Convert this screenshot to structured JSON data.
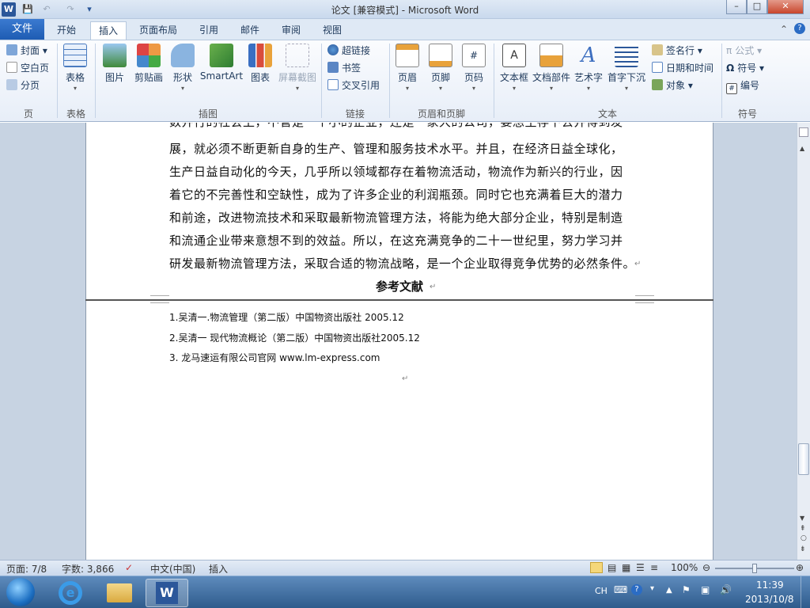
{
  "window": {
    "title": "论文 [兼容模式] - Microsoft Word",
    "minimize": "–",
    "maximize": "□",
    "close": "✕"
  },
  "qat": {
    "app_icon": "W",
    "save": "💾",
    "undo": "↶",
    "redo": "↷",
    "customize": "▾"
  },
  "tabs": {
    "file": "文件",
    "items": [
      "开始",
      "插入",
      "页面布局",
      "引用",
      "邮件",
      "审阅",
      "视图"
    ],
    "active": "插入"
  },
  "ribbon": {
    "page_group": {
      "label": "页",
      "items": [
        "封面",
        "空白页",
        "分页"
      ]
    },
    "table_group": {
      "label": "表格",
      "table": "表格"
    },
    "illustrations_group": {
      "label": "插图",
      "items": [
        "图片",
        "剪贴画",
        "形状",
        "SmartArt",
        "图表",
        "屏幕截图"
      ]
    },
    "links_group": {
      "label": "链接",
      "items": [
        "超链接",
        "书签",
        "交叉引用"
      ]
    },
    "header_footer_group": {
      "label": "页眉和页脚",
      "items": [
        "页眉",
        "页脚",
        "页码"
      ]
    },
    "text_group": {
      "label": "文本",
      "items": [
        "文本框",
        "文档部件",
        "艺术字",
        "首字下沉"
      ],
      "small": [
        "签名行",
        "日期和时间",
        "对象"
      ]
    },
    "symbols_group": {
      "label": "符号",
      "items": [
        "公式",
        "符号",
        "编号"
      ]
    }
  },
  "document": {
    "partial_top": "数并行的社会上，不管是一个小的企业，还是一家大的公司，要想生存下去并得到发",
    "body_lines": [
      "展，就必须不断更新自身的生产、管理和服务技术水平。并且，在经济日益全球化，",
      "生产日益自动化的今天，几乎所以领域都存在着物流活动，物流作为新兴的行业，因",
      "着它的不完善性和空缺性，成为了许多企业的利润瓶颈。同时它也充满着巨大的潜力",
      "和前途，改进物流技术和采取最新物流管理方法，将能为绝大部分企业，特别是制造",
      "和流通企业带来意想不到的效益。所以，在这充满竞争的二十一世纪里，努力学习并",
      "研发最新物流管理方法，采取合适的物流战略，是一个企业取得竞争优势的必然条件。"
    ],
    "heading": "参考文献",
    "references": [
      "1.吴清一.物流管理（第二版）中国物资出版社  2005.12",
      "2.吴清一 现代物流概论（第二版）中国物资出版社2005.12",
      "3.  龙马速运有限公司官网  www.lm-express.com"
    ],
    "paragraph_mark": "↵"
  },
  "status": {
    "page": "页面: 7/8",
    "words": "字数: 3,866",
    "language": "中文(中国)",
    "mode": "插入",
    "zoom": "100%",
    "zoom_level": 100
  },
  "taskbar": {
    "ime": "CH",
    "time": "11:39",
    "date": "2013/10/8"
  },
  "colors": {
    "file_tab": "#2a6ac0",
    "ribbon_bg": "#e7eef8",
    "doc_bg": "#c7d3e2",
    "taskbar": "#3b6a9e"
  }
}
